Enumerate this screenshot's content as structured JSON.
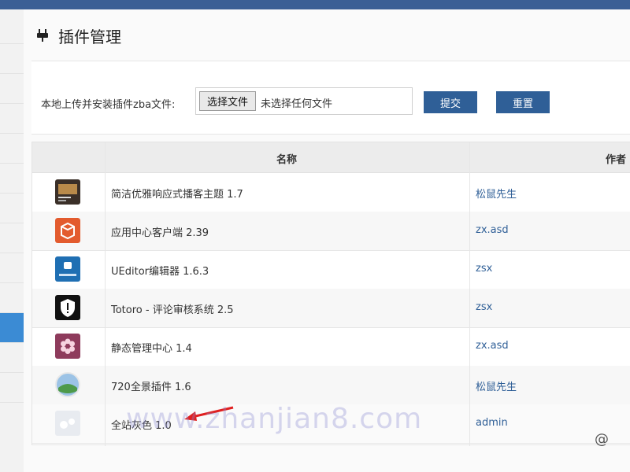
{
  "page": {
    "title": "插件管理",
    "upload_label": "本地上传并安装插件zba文件:",
    "file_button": "选择文件",
    "file_status": "未选择任何文件",
    "submit": "提交",
    "reset": "重置"
  },
  "table": {
    "headers": {
      "name": "名称",
      "author": "作者"
    },
    "rows": [
      {
        "name": "简洁优雅响应式播客主题 1.7",
        "author": "松鼠先生",
        "icon": "theme-thumbnail-icon"
      },
      {
        "name": "应用中心客户端 2.39",
        "author": "zx.asd",
        "icon": "box-icon"
      },
      {
        "name": "UEditor编辑器 1.6.3",
        "author": "zsx",
        "icon": "ueditor-icon"
      },
      {
        "name": "Totoro - 评论审核系统 2.5",
        "author": "zsx",
        "icon": "shield-icon"
      },
      {
        "name": "静态管理中心 1.4",
        "author": "zx.asd",
        "icon": "flower-icon"
      },
      {
        "name": "720全景插件 1.6",
        "author": "松鼠先生",
        "icon": "panorama-icon"
      },
      {
        "name": "全站灰色 1.0",
        "author": "admin",
        "icon": "gray-dots-icon"
      }
    ]
  },
  "watermark": "www.zhanjian8.com",
  "corner_mark": "@"
}
